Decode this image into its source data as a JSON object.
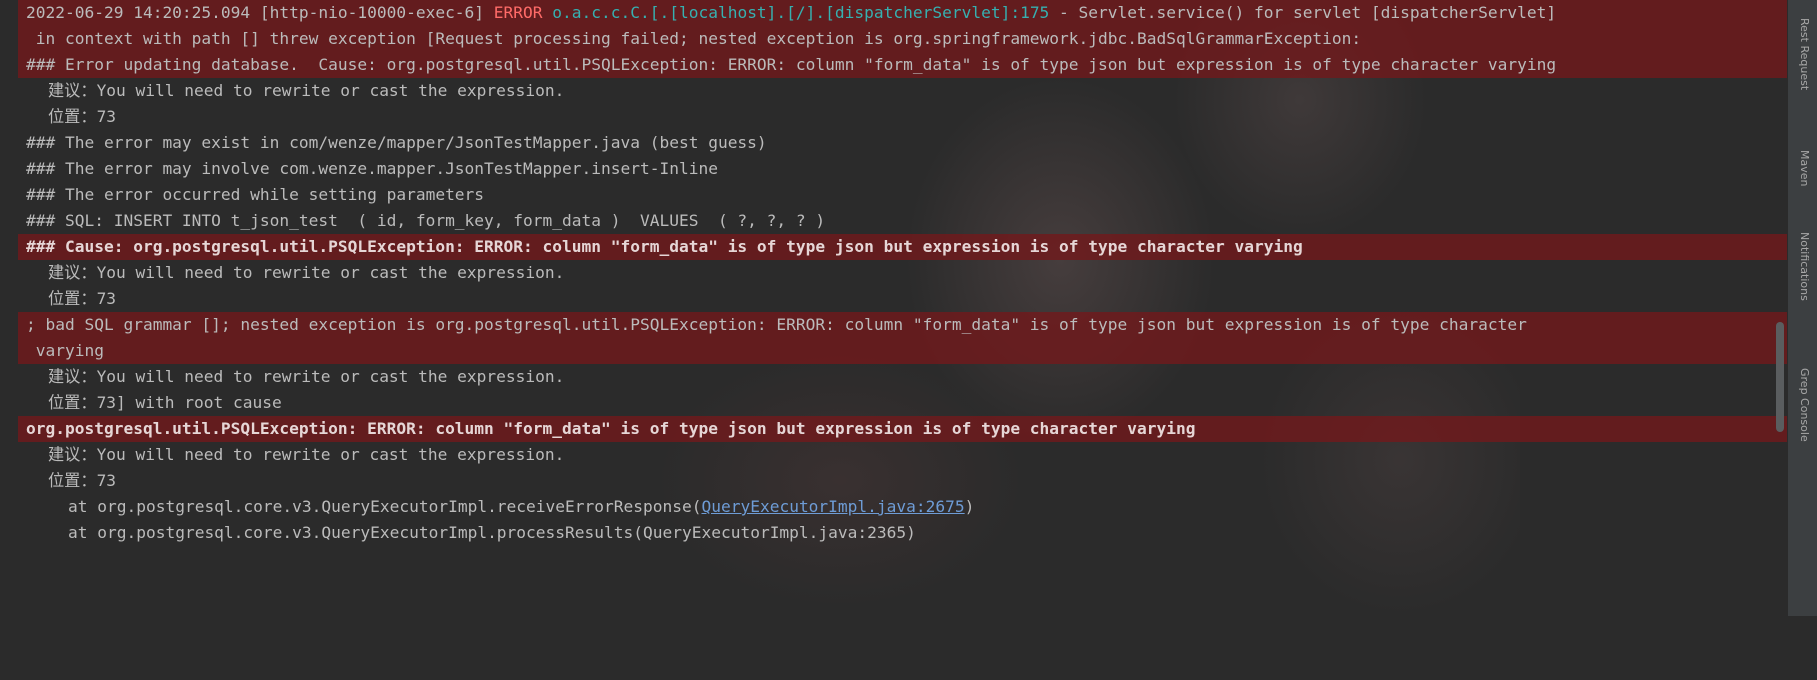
{
  "console": {
    "line1": {
      "timestamp_thread": "2022-06-29 14:20:25.094 [http-nio-10000-exec-6] ",
      "level": "ERROR",
      "logger": " o.a.c.c.C.[.[localhost].[/].[dispatcherServlet]:175",
      "message": " - Servlet.service() for servlet [dispatcherServlet]"
    },
    "line2": " in context with path [] threw exception [Request processing failed; nested exception is org.springframework.jdbc.BadSqlGrammarException:",
    "line3": "### Error updating database.  Cause: org.postgresql.util.PSQLException: ERROR: column \"form_data\" is of type json but expression is of type character varying",
    "hint_label": "建议：",
    "hint_text": "You will need to rewrite or cast the expression.",
    "position_label": "位置：",
    "position_value": "73",
    "line6": "### The error may exist in com/wenze/mapper/JsonTestMapper.java (best guess)",
    "line7": "### The error may involve com.wenze.mapper.JsonTestMapper.insert-Inline",
    "line8": "### The error occurred while setting parameters",
    "line9": "### SQL: INSERT INTO t_json_test  ( id, form_key, form_data )  VALUES  ( ?, ?, ? )",
    "line10": "### Cause: org.postgresql.util.PSQLException: ERROR: column \"form_data\" is of type json but expression is of type character varying",
    "line13a": "; bad SQL grammar []; nested exception is org.postgresql.util.PSQLException: ERROR: column \"form_data\" is of type json but expression is of type character",
    "line13b": " varying",
    "position_value_root": "73] with root cause",
    "line17": "org.postgresql.util.PSQLException: ERROR: column \"form_data\" is of type json but expression is of type character varying",
    "stack1_prefix": "at org.postgresql.core.v3.QueryExecutorImpl.receiveErrorResponse(",
    "stack1_link": "QueryExecutorImpl.java:2675",
    "stack1_suffix": ")",
    "stack2_partial": "at org.postgresql.core.v3.QueryExecutorImpl.processResults(QueryExecutorImpl.java:2365)"
  },
  "right_tool_tabs": [
    "Rest Request",
    "Maven",
    "Notifications",
    "Grep Console"
  ],
  "colors": {
    "background": "#2b2b2b",
    "error_highlight": "#701a1c",
    "error_level": "#ff6b68",
    "logger_teal": "#36b0b0",
    "link_blue": "#6e9cd6"
  }
}
